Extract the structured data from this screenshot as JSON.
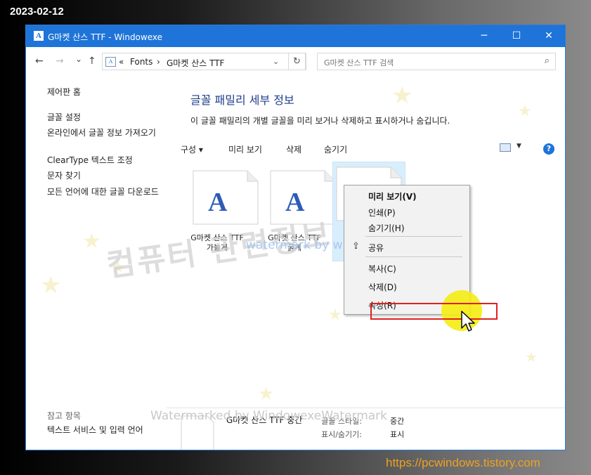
{
  "overlay": {
    "date": "2023-02-12",
    "url": "https://pcwindows.tistory.com",
    "watermark_main": "컴퓨터 관련정보",
    "watermark_blue": "watermark by windowexe",
    "watermark_bottom": "Watermarked by WindowexeWatermark"
  },
  "window": {
    "title": "G마켓 산스 TTF  - Windowexe",
    "controls": {
      "minimize": "─",
      "maximize": "☐",
      "close": "✕"
    }
  },
  "navbar": {
    "back": "←",
    "forward": "→",
    "recent": "⌄",
    "up": "↑",
    "breadcrumb": [
      "«",
      "Fonts",
      "›",
      "G마켓 산스 TTF"
    ],
    "dropdown": "⌄",
    "refresh": "↻",
    "search_placeholder": "G마켓 산스 TTF 검색",
    "search_icon": "⌕"
  },
  "sidebar": {
    "links": [
      "제어판 홈",
      "글꼴 설정",
      "온라인에서 글꼴 정보 가져오기",
      "ClearType 텍스트 조정",
      "문자 찾기",
      "모든 언어에 대한 글꼴 다운로드"
    ],
    "see_also": "참고 항목",
    "see_also_link": "텍스트 서비스 및 입력 언어"
  },
  "main": {
    "title": "글꼴 패밀리 세부 정보",
    "description": "이 글꼴 패밀리의 개별 글꼴을 미리 보거나 삭제하고 표시하거나 숨깁니다.",
    "toolbar": {
      "organize": "구성 ▾",
      "preview": "미리 보기",
      "delete": "삭제",
      "hide": "숨기기",
      "view_dropdown": "▼",
      "help": "?"
    },
    "tiles": [
      {
        "line1": "G마켓 산스 TTF",
        "line2": "가늘게"
      },
      {
        "line1": "G마켓 산스 TTF",
        "line2": "굵게"
      },
      {
        "line1": "G마켓 산",
        "line2": "중"
      }
    ],
    "glyph": "A"
  },
  "details": {
    "name": "G마켓 산스 TTF 중간",
    "style_label": "글꼴 스타일:",
    "style_value": "중간",
    "visibility_label": "표시/숨기기:",
    "visibility_value": "표시"
  },
  "context_menu": {
    "items": [
      "미리 보기(V)",
      "인쇄(P)",
      "숨기기(H)",
      "공유",
      "복사(C)",
      "삭제(D)",
      "속성(R)"
    ],
    "highlighted_color": "#e02020"
  },
  "colors": {
    "titlebar": "#1e74d8",
    "title_text": "#1e3d8a",
    "url": "#f0a020"
  }
}
